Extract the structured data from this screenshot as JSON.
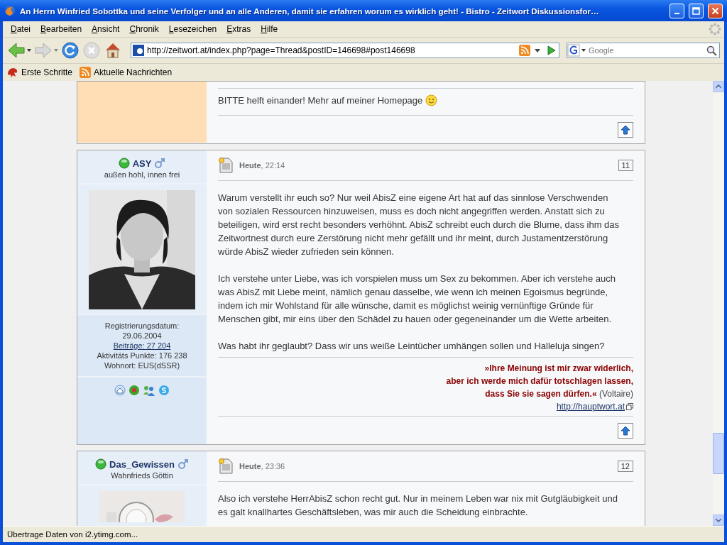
{
  "window": {
    "title": "An Herrn Winfried Sobottka und seine Verfolger und an alle Anderen, damit sie erfahren worum es wirklich geht! - Bistro - Zeitwort Diskussionsfor…"
  },
  "menu": [
    "Datei",
    "Bearbeiten",
    "Ansicht",
    "Chronik",
    "Lesezeichen",
    "Extras",
    "Hilfe"
  ],
  "address": {
    "value": "http://zeitwort.at/index.php?page=Thread&postID=146698#post146698"
  },
  "search": {
    "placeholder": "Google"
  },
  "bookmarks": [
    "Erste Schritte",
    "Aktuelle Nachrichten"
  ],
  "posts": [
    {
      "kind": "partial",
      "signature": "BITTE helft einander! Mehr auf meiner Homepage"
    },
    {
      "kind": "full",
      "user": {
        "name": "ASY",
        "online": true,
        "title": "außen hohl, innen frei"
      },
      "picture": {
        "kind": "picture"
      },
      "stats": {
        "registered_label": "Registrierungsdatum:",
        "registered": "29.06.2004",
        "posts_link": "Beiträge: 27 204",
        "points": "Aktivitäts Punkte: 176 238",
        "location": "Wohnort: EUS(dSSR)"
      },
      "date": "Heute",
      "time": ", 22:14",
      "number": "11",
      "paragraphs": [
        "Warum verstellt ihr euch so? Nur weil AbisZ eine eigene Art hat auf das sinnlose Verschwenden von sozialen Ressourcen hinzuweisen, muss es doch nicht angegriffen werden. Anstatt sich zu beteiligen, wird erst recht besonders verhöhnt. AbisZ schreibt euch durch die Blume, dass ihm das Zeitwortnest durch eure Zerstörung nicht mehr gefällt und ihr meint, durch Justamentzerstörung würde AbisZ wieder zufrieden sein können.",
        "Ich verstehe unter Liebe, was ich vorspielen muss um Sex zu bekommen. Aber ich verstehe auch was AbisZ mit Liebe meint, nämlich genau dasselbe, wie wenn ich meinen Egoismus begründe, indem ich mir Wohlstand für alle wünsche, damit es möglichst weinig vernünftige Gründe für Menschen gibt, mir eins über den Schädel zu hauen oder gegeneinander um die Wette arbeiten.",
        "Was habt ihr geglaubt? Dass wir uns weiße Leintücher umhängen sollen und Halleluja singen?"
      ],
      "quote": [
        "»Ihre Meinung ist mir zwar widerlich,",
        "aber ich werde mich dafür totschlagen lassen,",
        "dass Sie sie sagen dürfen.«"
      ],
      "quote_source": "(Voltaire)",
      "homepage_link": "http://hauptwort.at"
    },
    {
      "kind": "full",
      "user": {
        "name": "Das_Gewissen",
        "online": true,
        "title": "Wahnfrieds Göttin"
      },
      "picture": {
        "kind": "picture"
      },
      "date": "Heute",
      "time": ", 23:36",
      "number": "12",
      "paragraphs": [
        "Also ich verstehe HerrAbisZ schon recht gut. Nur in meinem Leben war nix mit Gutgläubigkeit und es galt knallhartes Geschäftsleben, was mir auch die Scheidung einbrachte."
      ]
    }
  ],
  "status_bar": "Übertrage Daten von i2.ytimg.com..."
}
